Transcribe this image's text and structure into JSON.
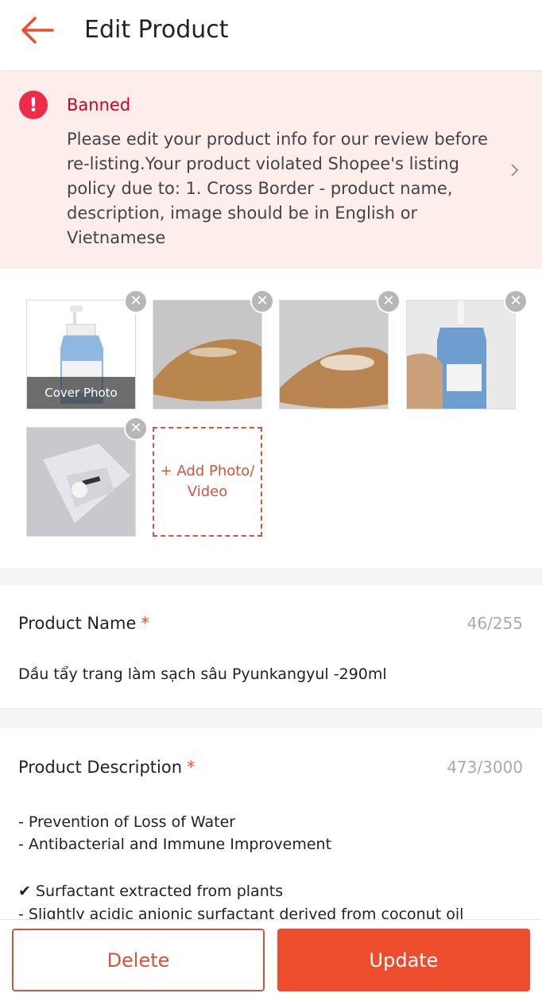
{
  "header": {
    "title": "Edit Product",
    "back_icon": "arrow-left-icon"
  },
  "banner": {
    "status": "Banned",
    "message": "Please edit your product info for our review before re-listing.Your product violated Shopee's listing policy due to: 1. Cross Border - product name, description, image should be in English or Vietnamese",
    "icon": "alert-circle-icon"
  },
  "photos": {
    "cover_label": "Cover Photo",
    "add_label": "+ Add Photo/ Video",
    "count": 5
  },
  "product_name": {
    "label": "Product Name",
    "required_mark": "*",
    "counter": "46/255",
    "value": "Dầu tẩy trang làm sạch sâu Pyunkangyul -290ml"
  },
  "product_description": {
    "label": "Product Description",
    "required_mark": "*",
    "counter": "473/3000",
    "lines": [
      "- Prevention of Loss of Water",
      "- Antibacterial and Immune Improvement",
      "✔ Surfactant extracted from plants",
      "- Slightly acidic anionic surfactant derived from coconut oil"
    ]
  },
  "footer": {
    "delete_label": "Delete",
    "update_label": "Update"
  },
  "colors": {
    "accent": "#ee4d2d",
    "banned": "#d0011b",
    "banner_bg": "#fdeeec"
  }
}
